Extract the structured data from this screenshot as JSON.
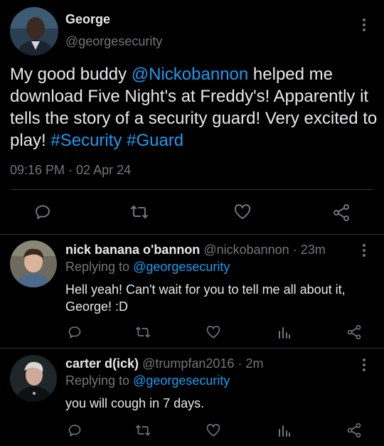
{
  "main_tweet": {
    "display_name": "George",
    "handle": "@georgesecurity",
    "text_part1": "My good buddy ",
    "mention": "@Nickobannon",
    "text_part2": " helped me download Five Night's at Freddy's! Apparently it tells the story of a security guard! Very excited to play! ",
    "hashtag1": "#Security",
    "hashtag2": "#Guard",
    "timestamp": "09:16 PM · 02 Apr 24"
  },
  "replies": [
    {
      "display_name": "nick banana o'bannon",
      "handle": "@nickobannon",
      "time": "· 23m",
      "replying_prefix": "Replying to ",
      "replying_to": "@georgesecurity",
      "text": "Hell yeah! Can't wait for you to tell me all about it, George! :D"
    },
    {
      "display_name": "carter d(ick)",
      "handle": "@trumpfan2016",
      "time": "· 2m",
      "replying_prefix": "Replying to ",
      "replying_to": "@georgesecurity",
      "text": "you will cough in 7 days."
    }
  ],
  "colors": {
    "background": "#000000",
    "text": "#e7e9ea",
    "muted": "#71767b",
    "link": "#1d9bf0",
    "divider": "#2f3336"
  },
  "icons": [
    "reply-icon",
    "retweet-icon",
    "like-icon",
    "share-icon",
    "analytics-icon",
    "more-icon"
  ]
}
